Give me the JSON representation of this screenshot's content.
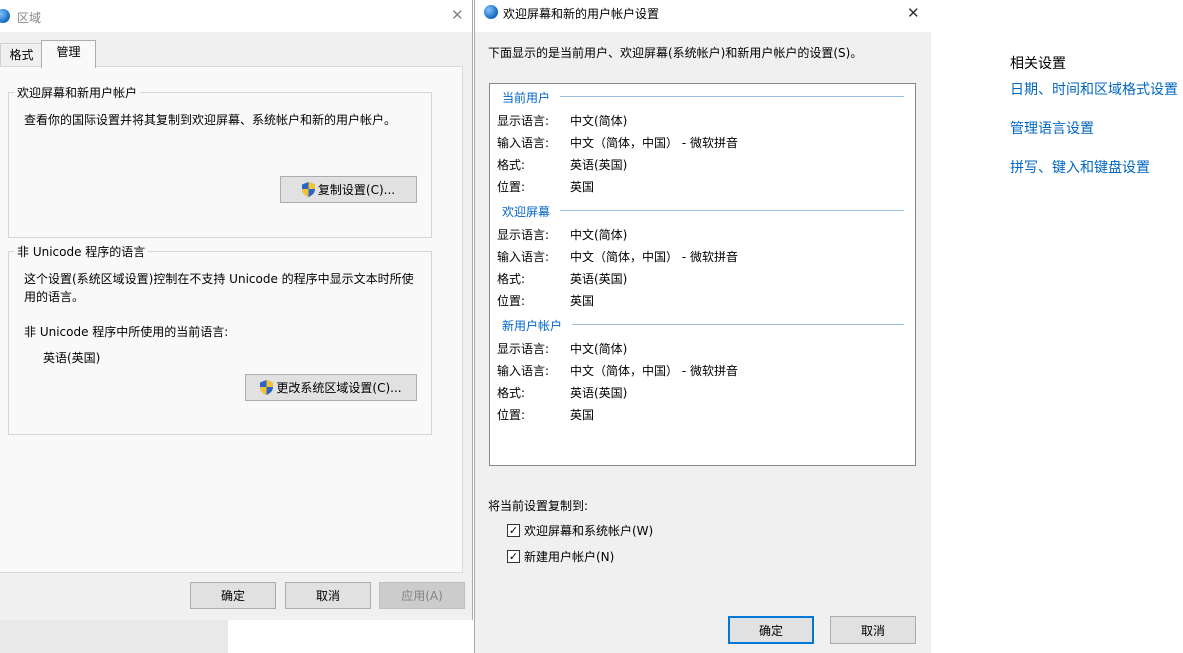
{
  "region_dialog": {
    "title": "区域",
    "tabs": [
      {
        "label": "格式",
        "active": false
      },
      {
        "label": "管理",
        "active": true
      }
    ],
    "welcome_group": {
      "title": "欢迎屏幕和新用户帐户",
      "description": "查看你的国际设置并将其复制到欢迎屏幕、系统帐户和新的用户帐户。",
      "copy_button": "复制设置(C)..."
    },
    "unicode_group": {
      "title": "非 Unicode 程序的语言",
      "description_line1": "这个设置(系统区域设置)控制在不支持 Unicode 的程序中显示文本时所使",
      "description_line2": "用的语言。",
      "current_label": "非 Unicode 程序中所使用的当前语言:",
      "current_value": "英语(英国)",
      "change_button": "更改系统区域设置(C)..."
    },
    "buttons": {
      "ok": "确定",
      "cancel": "取消",
      "apply": "应用(A)"
    }
  },
  "welcome_dialog": {
    "title": "欢迎屏幕和新的用户帐户设置",
    "intro": "下面显示的是当前用户、欢迎屏幕(系统帐户)和新用户帐户的设置(S)。",
    "sections": [
      {
        "title": "当前用户",
        "rows": [
          {
            "label": "显示语言:",
            "value": "中文(简体)"
          },
          {
            "label": "输入语言:",
            "value": "中文（简体，中国） - 微软拼音"
          },
          {
            "label": "格式:",
            "value": "英语(英国)"
          },
          {
            "label": "位置:",
            "value": "英国"
          }
        ]
      },
      {
        "title": "欢迎屏幕",
        "rows": [
          {
            "label": "显示语言:",
            "value": "中文(简体)"
          },
          {
            "label": "输入语言:",
            "value": "中文（简体，中国） - 微软拼音"
          },
          {
            "label": "格式:",
            "value": "英语(英国)"
          },
          {
            "label": "位置:",
            "value": "英国"
          }
        ]
      },
      {
        "title": "新用户帐户",
        "rows": [
          {
            "label": "显示语言:",
            "value": "中文(简体)"
          },
          {
            "label": "输入语言:",
            "value": "中文（简体，中国） - 微软拼音"
          },
          {
            "label": "格式:",
            "value": "英语(英国)"
          },
          {
            "label": "位置:",
            "value": "英国"
          }
        ]
      }
    ],
    "copy_heading": "将当前设置复制到:",
    "checkboxes": [
      {
        "label": "欢迎屏幕和系统帐户(W)",
        "checked": true
      },
      {
        "label": "新建用户帐户(N)",
        "checked": true
      }
    ],
    "buttons": {
      "ok": "确定",
      "cancel": "取消"
    }
  },
  "related_settings": {
    "heading": "相关设置",
    "links": [
      "日期、时间和区域格式设置",
      "管理语言设置",
      "拼写、键入和键盘设置"
    ]
  }
}
